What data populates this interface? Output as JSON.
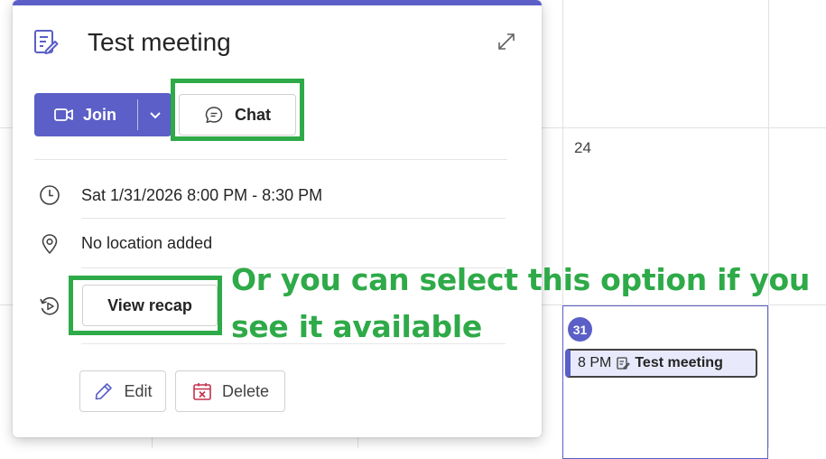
{
  "calendar": {
    "date_24": "24",
    "today_date": "31",
    "event_chip": {
      "time": "8 PM",
      "title": "Test meeting",
      "icon": "meeting-note-icon"
    }
  },
  "popup": {
    "title": "Test meeting",
    "title_icon": "meeting-note-icon",
    "expand_icon": "expand-icon",
    "join": {
      "label": "Join",
      "icon": "video-camera-icon",
      "dropdown_icon": "chevron-down-icon"
    },
    "chat": {
      "label": "Chat",
      "icon": "chat-bubble-icon"
    },
    "details": {
      "datetime": "Sat 1/31/2026 8:00 PM - 8:30 PM",
      "datetime_icon": "clock-icon",
      "location": "No location added",
      "location_icon": "location-pin-icon",
      "recap_icon": "recap-play-icon"
    },
    "view_recap_label": "View recap",
    "edit_label": "Edit",
    "delete_label": "Delete"
  },
  "annotation": {
    "line1": "Or you can select this option if you",
    "line2": "see it available"
  },
  "colors": {
    "accent": "#5b5fc7",
    "highlight": "#2eaa48",
    "delete_red": "#c4314b"
  }
}
